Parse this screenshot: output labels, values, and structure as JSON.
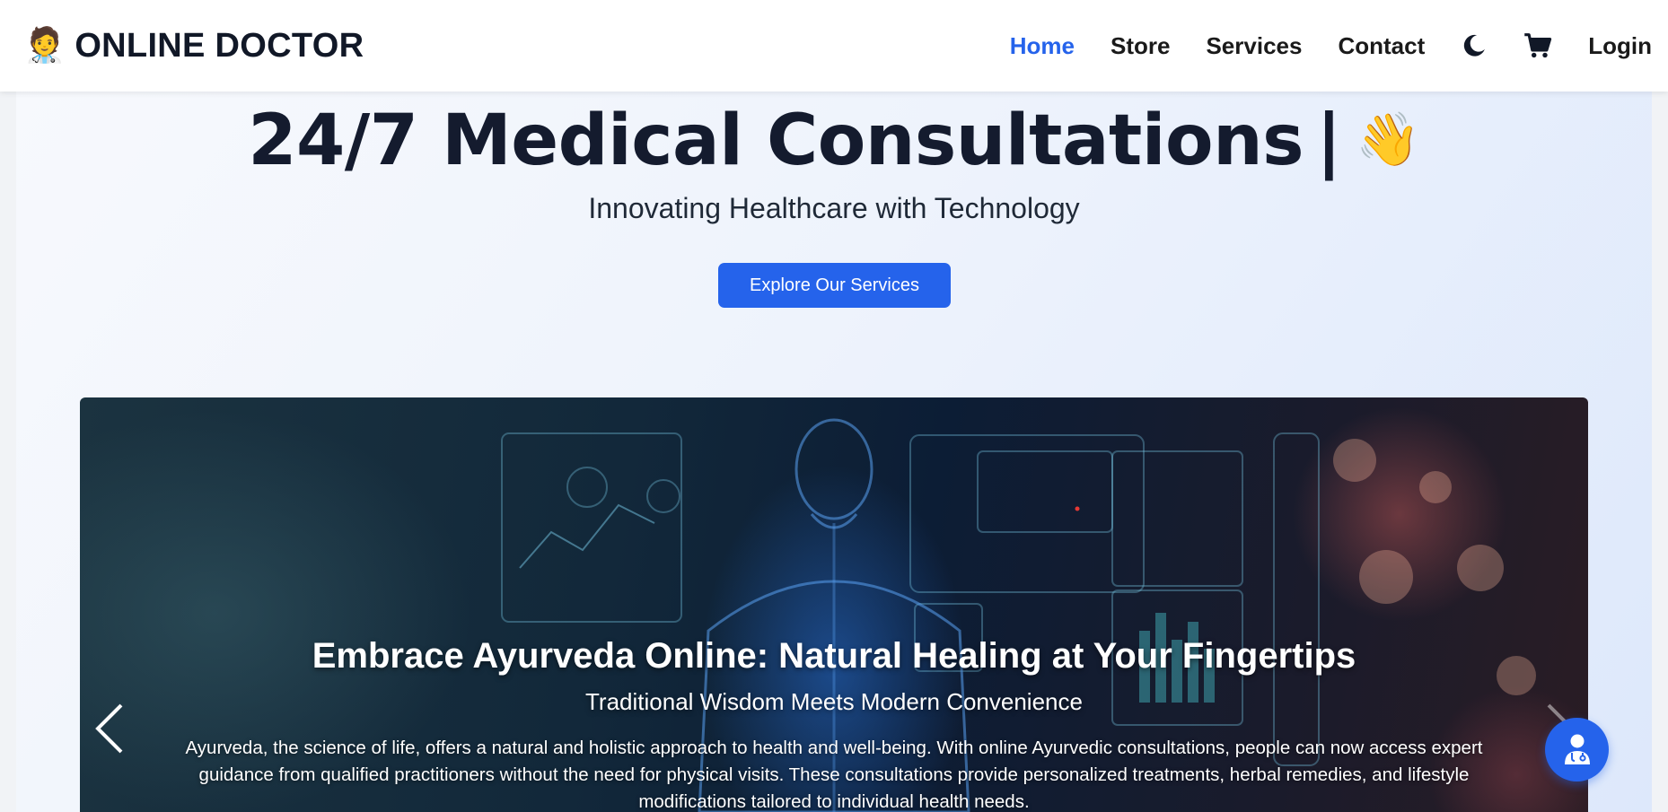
{
  "brand": {
    "icon": "doctor-icon",
    "emoji": "🧑‍⚕️",
    "name": "ONLINE DOCTOR"
  },
  "nav": {
    "links": [
      {
        "label": "Home",
        "active": true
      },
      {
        "label": "Store",
        "active": false
      },
      {
        "label": "Services",
        "active": false
      },
      {
        "label": "Contact",
        "active": false
      }
    ],
    "theme_toggle_icon": "moon-icon",
    "cart_icon": "cart-icon",
    "login_label": "Login"
  },
  "hero": {
    "title": "24/7 Medical Consultations",
    "cursor": "|",
    "emoji": "👋",
    "subtitle": "Innovating Healthcare with Technology",
    "cta_label": "Explore Our Services"
  },
  "carousel": {
    "slide_title": "Embrace Ayurveda Online: Natural Healing at Your Fingertips",
    "slide_subtitle": "Traditional Wisdom Meets Modern Convenience",
    "slide_body": "Ayurveda, the science of life, offers a natural and holistic approach to health and well-being. With online Ayurvedic consultations, people can now access expert guidance from qualified practitioners without the need for physical visits. These consultations provide personalized treatments, herbal remedies, and lifestyle modifications tailored to individual health needs.",
    "prev_icon": "chevron-left-icon",
    "next_icon": "chevron-right-icon"
  },
  "fab": {
    "icon": "doctor-support-icon"
  },
  "colors": {
    "accent": "#2563eb",
    "text_dark": "#141b2e",
    "nav_text": "#1a1a1a"
  }
}
